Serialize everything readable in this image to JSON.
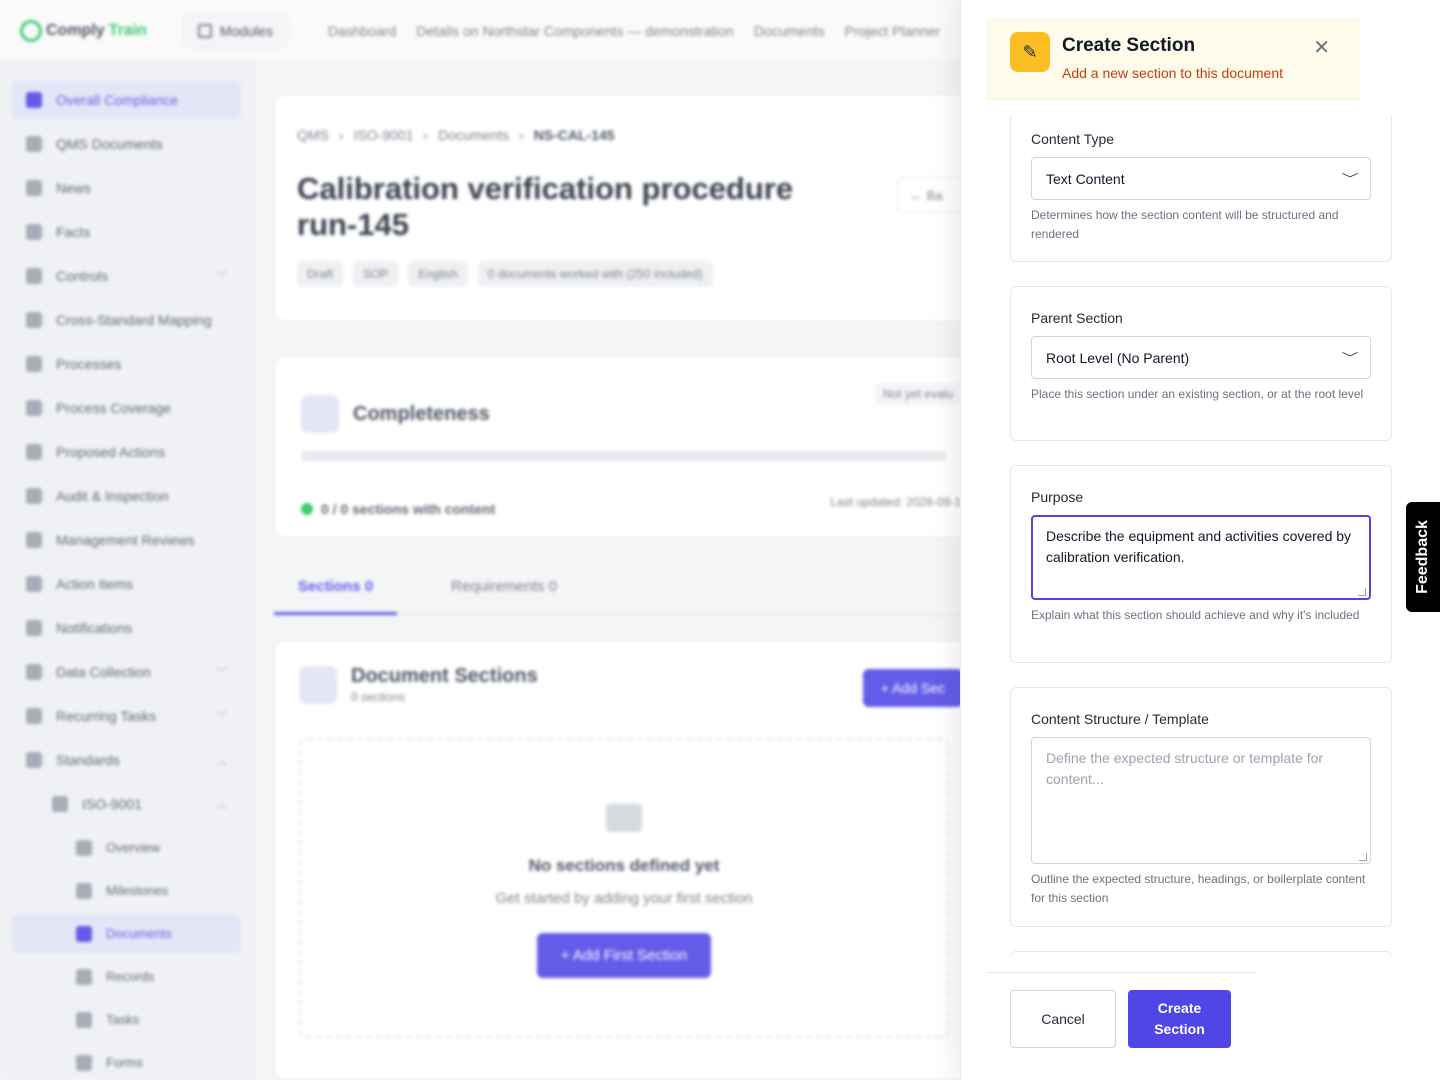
{
  "app": {
    "logo_part1": "Comply",
    "logo_part2": "Train",
    "modules_label": "Modules",
    "topnav": [
      "Dashboard",
      "Details on Northstar Components — demonstration",
      "Documents",
      "Project Planner"
    ]
  },
  "sidebar": {
    "items": [
      {
        "label": "Overall Compliance"
      },
      {
        "label": "QMS Documents"
      },
      {
        "label": "News"
      },
      {
        "label": "Facts"
      },
      {
        "label": "Controls"
      },
      {
        "label": "Cross-Standard Mapping"
      },
      {
        "label": "Processes"
      },
      {
        "label": "Process Coverage"
      },
      {
        "label": "Proposed Actions"
      },
      {
        "label": "Audit & Inspection"
      },
      {
        "label": "Management Reviews"
      },
      {
        "label": "Action Items"
      },
      {
        "label": "Notifications"
      },
      {
        "label": "Data Collection"
      },
      {
        "label": "Recurring Tasks"
      },
      {
        "label": "Standards"
      }
    ],
    "standard": {
      "label": "ISO-9001"
    },
    "standard_items": [
      "Overview",
      "Milestones",
      "Documents",
      "Records",
      "Tasks",
      "Forms"
    ]
  },
  "document": {
    "breadcrumb": [
      "QMS",
      "ISO-9001",
      "Documents",
      "NS-CAL-145"
    ],
    "title": "Calibration verification procedure run-145",
    "back_label": "Ba",
    "pills": [
      "Draft",
      "SOP",
      "English",
      "0 documents worked with (250 included)"
    ],
    "completeness": {
      "title": "Completeness",
      "status": "Not yet evalu",
      "summary": "0 / 0 sections with content",
      "updated": "Last updated: 2026-09-1"
    },
    "tabs": [
      {
        "label": "Sections",
        "count": "0"
      },
      {
        "label": "Requirements",
        "count": "0"
      }
    ],
    "sections": {
      "title": "Document Sections",
      "subtitle": "0 sections",
      "add_label": "+ Add Sec",
      "empty_title": "No sections defined yet",
      "empty_sub": "Get started by adding your first section",
      "add_first_label": "+ Add First Section"
    }
  },
  "drawer": {
    "title": "Create Section",
    "subtitle": "Add a new section to this document",
    "fields": {
      "content_type": {
        "label": "Content Type",
        "value": "Text Content",
        "help": "Determines how the section content will be structured and rendered"
      },
      "parent_section": {
        "label": "Parent Section",
        "value": "Root Level (No Parent)",
        "help": "Place this section under an existing section, or at the root level"
      },
      "purpose": {
        "label": "Purpose",
        "value": "Describe the equipment and activities covered by calibration verification.",
        "help": "Explain what this section should achieve and why it's included"
      },
      "content_structure": {
        "label": "Content Structure / Template",
        "placeholder": "Define the expected structure or template for content...",
        "help": "Outline the expected structure, headings, or boilerplate content for this section"
      }
    },
    "cancel_label": "Cancel",
    "create_label": "Create Section"
  },
  "feedback": {
    "label": "Feedback"
  },
  "colors": {
    "accent": "#4f46e5",
    "warning_bg": "#fffbeb",
    "warning_icon": "#fbbf24",
    "subtitle": "#c2410c"
  }
}
